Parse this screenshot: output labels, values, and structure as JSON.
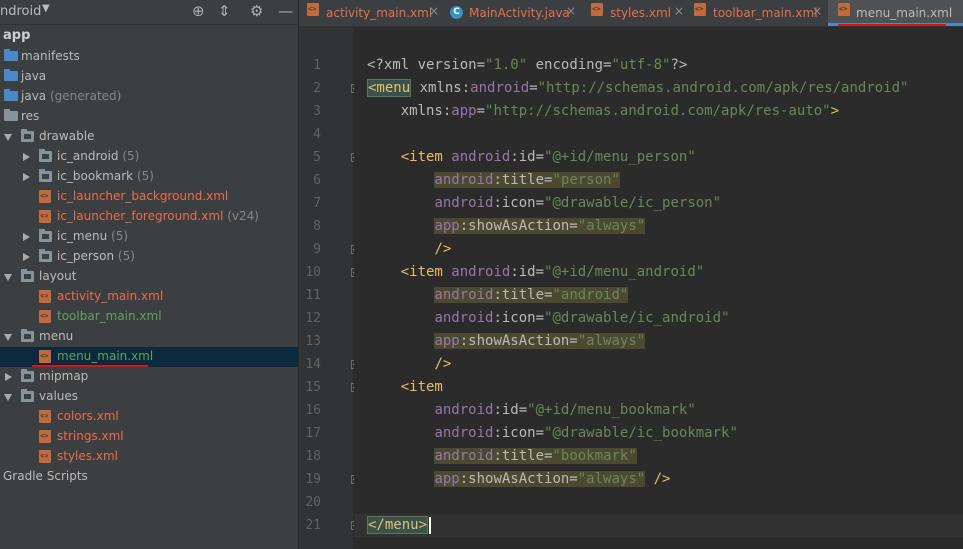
{
  "project_panel": {
    "view_label": "ndroid",
    "tree": [
      {
        "label": "app",
        "bold": true
      },
      {
        "label": "manifests"
      },
      {
        "label": "java"
      },
      {
        "label": "java",
        "suffix": "(generated)"
      },
      {
        "label": "res"
      },
      {
        "label": "drawable"
      },
      {
        "label": "ic_android",
        "suffix": "(5)"
      },
      {
        "label": "ic_bookmark",
        "suffix": "(5)"
      },
      {
        "label": "ic_launcher_background.xml"
      },
      {
        "label": "ic_launcher_foreground.xml",
        "suffix": "(v24)"
      },
      {
        "label": "ic_menu",
        "suffix": "(5)"
      },
      {
        "label": "ic_person",
        "suffix": "(5)"
      },
      {
        "label": "layout"
      },
      {
        "label": "activity_main.xml"
      },
      {
        "label": "toolbar_main.xml"
      },
      {
        "label": "menu"
      },
      {
        "label": "menu_main.xml"
      },
      {
        "label": "mipmap"
      },
      {
        "label": "values"
      },
      {
        "label": "colors.xml"
      },
      {
        "label": "strings.xml"
      },
      {
        "label": "styles.xml"
      },
      {
        "label": "Gradle Scripts"
      }
    ]
  },
  "tabs": [
    {
      "label": "activity_main.xml"
    },
    {
      "label": "MainActivity.java",
      "icon_text": "C"
    },
    {
      "label": "styles.xml"
    },
    {
      "label": "toolbar_main.xml"
    },
    {
      "label": "menu_main.xml",
      "active": true
    }
  ],
  "editor": {
    "line_numbers": [
      "1",
      "2",
      "3",
      "4",
      "5",
      "6",
      "7",
      "8",
      "9",
      "10",
      "11",
      "12",
      "13",
      "14",
      "15",
      "16",
      "17",
      "18",
      "19",
      "20",
      "21"
    ],
    "lines": [
      [
        {
          "t": "<?xml version=",
          "c": "c-attr"
        },
        {
          "t": "\"1.0\"",
          "c": "c-str"
        },
        {
          "t": " encoding=",
          "c": "c-attr"
        },
        {
          "t": "\"utf-8\"",
          "c": "c-str"
        },
        {
          "t": "?>",
          "c": "c-attr"
        }
      ],
      [
        {
          "t": "<menu",
          "c": "c-tag tagbox"
        },
        {
          "t": " xmlns:",
          "c": "c-attr"
        },
        {
          "t": "android",
          "c": "c-ns"
        },
        {
          "t": "=",
          "c": "c-attr"
        },
        {
          "t": "\"http://schemas.android.com/apk/res/android\"",
          "c": "c-str"
        }
      ],
      [
        {
          "t": "    xmlns:",
          "c": "c-attr"
        },
        {
          "t": "app",
          "c": "c-ns"
        },
        {
          "t": "=",
          "c": "c-attr"
        },
        {
          "t": "\"http://schemas.android.com/apk/res-auto\"",
          "c": "c-str"
        },
        {
          "t": ">",
          "c": "c-tag"
        }
      ],
      [],
      [
        {
          "t": "    ",
          "c": ""
        },
        {
          "t": "<item",
          "c": "c-tag"
        },
        {
          "t": " android",
          "c": "c-ns"
        },
        {
          "t": ":id=",
          "c": "c-attr"
        },
        {
          "t": "\"@+id/menu_person\"",
          "c": "c-str"
        }
      ],
      [
        {
          "t": "        ",
          "c": ""
        },
        {
          "t": "android",
          "c": "c-ns hl"
        },
        {
          "t": ":title=",
          "c": "c-attr hl"
        },
        {
          "t": "\"person\"",
          "c": "c-str hl"
        }
      ],
      [
        {
          "t": "        ",
          "c": ""
        },
        {
          "t": "android",
          "c": "c-ns"
        },
        {
          "t": ":icon=",
          "c": "c-attr"
        },
        {
          "t": "\"@drawable/ic_person\"",
          "c": "c-str"
        }
      ],
      [
        {
          "t": "        ",
          "c": ""
        },
        {
          "t": "app",
          "c": "c-ns hl"
        },
        {
          "t": ":showAsAction=",
          "c": "c-attr hl"
        },
        {
          "t": "\"always\"",
          "c": "c-str hl"
        }
      ],
      [
        {
          "t": "        ",
          "c": ""
        },
        {
          "t": "/>",
          "c": "c-tag"
        }
      ],
      [
        {
          "t": "    ",
          "c": ""
        },
        {
          "t": "<item",
          "c": "c-tag"
        },
        {
          "t": " android",
          "c": "c-ns"
        },
        {
          "t": ":id=",
          "c": "c-attr"
        },
        {
          "t": "\"@+id/menu_android\"",
          "c": "c-str"
        }
      ],
      [
        {
          "t": "        ",
          "c": ""
        },
        {
          "t": "android",
          "c": "c-ns hl"
        },
        {
          "t": ":title=",
          "c": "c-attr hl"
        },
        {
          "t": "\"android\"",
          "c": "c-str hl"
        }
      ],
      [
        {
          "t": "        ",
          "c": ""
        },
        {
          "t": "android",
          "c": "c-ns"
        },
        {
          "t": ":icon=",
          "c": "c-attr"
        },
        {
          "t": "\"@drawable/ic_android\"",
          "c": "c-str"
        }
      ],
      [
        {
          "t": "        ",
          "c": ""
        },
        {
          "t": "app",
          "c": "c-ns hl"
        },
        {
          "t": ":showAsAction=",
          "c": "c-attr hl"
        },
        {
          "t": "\"always\"",
          "c": "c-str hl"
        }
      ],
      [
        {
          "t": "        ",
          "c": ""
        },
        {
          "t": "/>",
          "c": "c-tag"
        }
      ],
      [
        {
          "t": "    ",
          "c": ""
        },
        {
          "t": "<item",
          "c": "c-tag"
        }
      ],
      [
        {
          "t": "        ",
          "c": ""
        },
        {
          "t": "android",
          "c": "c-ns"
        },
        {
          "t": ":id=",
          "c": "c-attr"
        },
        {
          "t": "\"@+id/menu_bookmark\"",
          "c": "c-str"
        }
      ],
      [
        {
          "t": "        ",
          "c": ""
        },
        {
          "t": "android",
          "c": "c-ns"
        },
        {
          "t": ":icon=",
          "c": "c-attr"
        },
        {
          "t": "\"@drawable/ic_bookmark\"",
          "c": "c-str"
        }
      ],
      [
        {
          "t": "        ",
          "c": ""
        },
        {
          "t": "android",
          "c": "c-ns hl"
        },
        {
          "t": ":title=",
          "c": "c-attr hl"
        },
        {
          "t": "\"bookmark\"",
          "c": "c-str hl"
        }
      ],
      [
        {
          "t": "        ",
          "c": ""
        },
        {
          "t": "app",
          "c": "c-ns hl"
        },
        {
          "t": ":showAsAction=",
          "c": "c-attr hl"
        },
        {
          "t": "\"always\"",
          "c": "c-str hl"
        },
        {
          "t": " />",
          "c": "c-tag"
        }
      ],
      [],
      [
        {
          "t": "</menu>",
          "c": "c-tag tagbox"
        }
      ]
    ]
  },
  "colors": {
    "background": "#2b2b2b",
    "panel": "#3c3f41",
    "selection": "#0d293e",
    "tab_accent": "#4a88c7",
    "annotation_underline": "#e01010"
  }
}
